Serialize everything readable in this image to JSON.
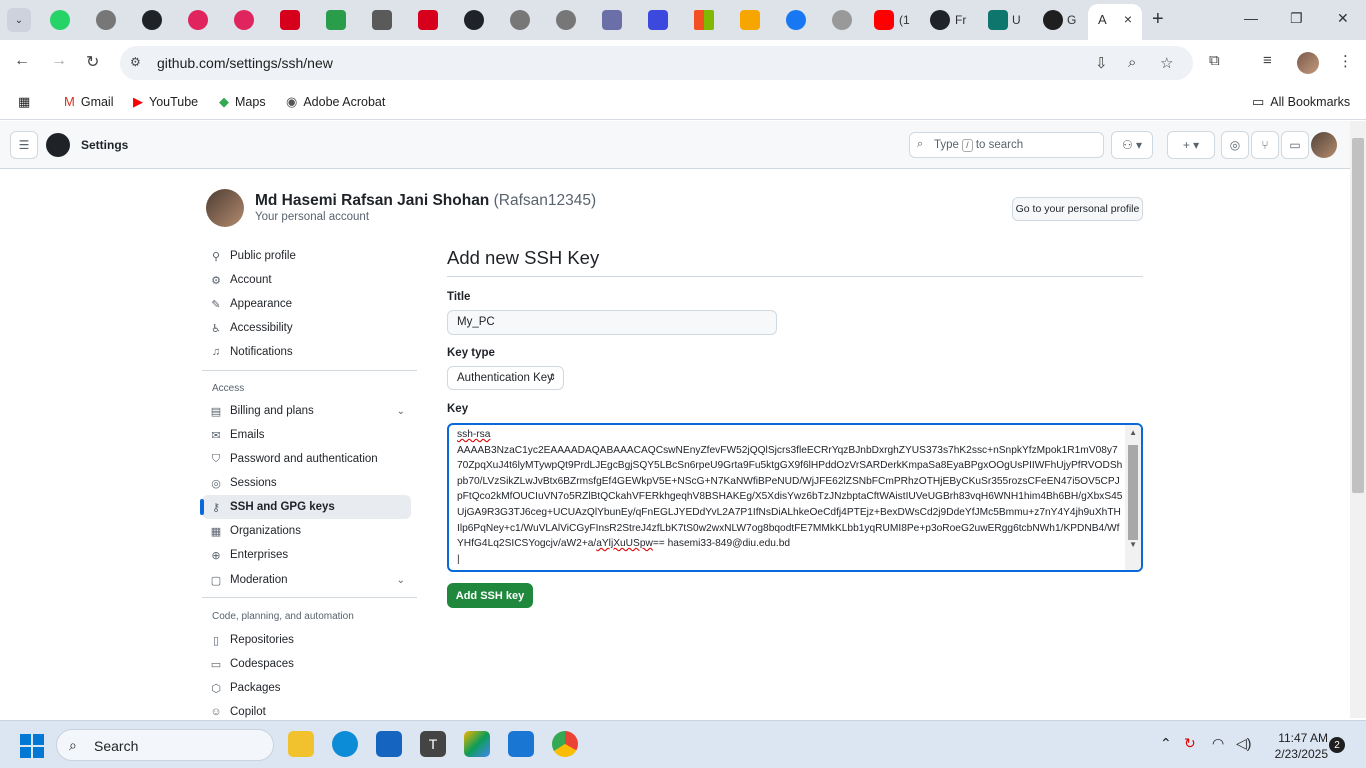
{
  "browser": {
    "active_tab": {
      "title": "A",
      "close_icon": "×"
    },
    "partial_tabs": [
      "(1",
      "Fr",
      "U",
      "G"
    ],
    "url": "github.com/settings/ssh/new",
    "new_tab_label": "+"
  },
  "bookmarks": [
    {
      "label": "Gmail",
      "icon": "gmail-icon"
    },
    {
      "label": "YouTube",
      "icon": "youtube-icon"
    },
    {
      "label": "Maps",
      "icon": "maps-icon"
    },
    {
      "label": "Adobe Acrobat",
      "icon": "acrobat-icon"
    }
  ],
  "all_bookmarks": "All Bookmarks",
  "header": {
    "title": "Settings",
    "search_prefix": "Type",
    "search_key": "/",
    "search_suffix": "to search"
  },
  "profile": {
    "name": "Md Hasemi Rafsan Jani Shohan",
    "handle": "(Rafsan12345)",
    "subtitle": "Your personal account",
    "go_button": "Go to your personal profile"
  },
  "sidebar": {
    "items": [
      {
        "label": "Public profile",
        "icon": "person-icon"
      },
      {
        "label": "Account",
        "icon": "gear-icon"
      },
      {
        "label": "Appearance",
        "icon": "paintbrush-icon"
      },
      {
        "label": "Accessibility",
        "icon": "accessibility-icon"
      },
      {
        "label": "Notifications",
        "icon": "bell-icon"
      }
    ],
    "access_heading": "Access",
    "access_items": [
      {
        "label": "Billing and plans",
        "icon": "billing-icon"
      },
      {
        "label": "Emails",
        "icon": "mail-icon"
      },
      {
        "label": "Password and authentication",
        "icon": "shield-icon"
      },
      {
        "label": "Sessions",
        "icon": "broadcast-icon"
      },
      {
        "label": "SSH and GPG keys",
        "icon": "key-icon"
      },
      {
        "label": "Organizations",
        "icon": "organization-icon"
      },
      {
        "label": "Enterprises",
        "icon": "globe-icon"
      },
      {
        "label": "Moderation",
        "icon": "report-icon"
      }
    ],
    "code_heading": "Code, planning, and automation",
    "code_items": [
      {
        "label": "Repositories",
        "icon": "repo-icon"
      },
      {
        "label": "Codespaces",
        "icon": "codespaces-icon"
      },
      {
        "label": "Packages",
        "icon": "package-icon"
      },
      {
        "label": "Copilot",
        "icon": "copilot-icon"
      }
    ]
  },
  "form": {
    "heading": "Add new SSH Key",
    "title_label": "Title",
    "title_value": "My_PC",
    "key_type_label": "Key type",
    "key_type_value": "Authentication Key",
    "key_label": "Key",
    "key_line1": "ssh-rsa",
    "key_body": "AAAAB3NzaC1yc2EAAAADAQABAAACAQCswNEnyZfevFW52jQQlSjcrs3fleECRrYqzBJnbDxrghZYUS373s7hK2ssc+nSnpkYfzMpok1R1mV08y770ZpqXuJ4t6lyMTywpQt9PrdLJEgcBgjSQY5LBcSn6rpeU9Grta9Fu5ktgGX9f6lHPddOzVrSARDerkKmpaSa8EyaBPgxOOgUsPIIWFhUjyPfRVODShpb70/LVzSikZLwJvBtx6BZrmsfgEf4GEWkpV5E+NScG+N7KaNWfiBPeNUD/WjJFE62lZSNbFCmPRhzOTHjEByCKuSr355rozsCFeEN47i5OV5CPJpFtQco2kMfOUCIuVN7o5RZlBtQCkahVFERkhgeqhV8BSHAKEg/X5XdisYwz6bTzJNzbptaCftWAistIUVeUGBrh83vqH6WNH1him4Bh6BH/gXbxS45UjGA9R3G3TJ6ceg+UCUAzQlYbunEy/qFnEGLJYEDdYvL2A7P1IfNsDiALhkeOeCdfj4PTEjz+BexDWsCd2j9DdeYfJMc5Bmmu+z7nY4Y4jh9uXhTHIlp6PqNey+c1/WuVLAlViCGyFInsR2StreJ4zfLbK7tS0w2wxNLW7og8bqodtFE7MMkKLbb1yqRUMI8Pe+p3oRoeG2uwERgg6tcbNWh1/KPDNB4/WfYHfG4Lq2SICSYogcjv/aW2+a/",
    "key_underlined": "aYljXuUSpw",
    "key_tail": "== hasemi33-849@diu.edu.bd",
    "submit_label": "Add SSH key"
  },
  "taskbar": {
    "search_label": "Search",
    "time": "11:47 AM",
    "date": "2/23/2025",
    "notification_count": "2"
  },
  "colors": {
    "primary_button": "#1f883d",
    "focus_border": "#0969da",
    "active_indicator": "#0969da"
  }
}
